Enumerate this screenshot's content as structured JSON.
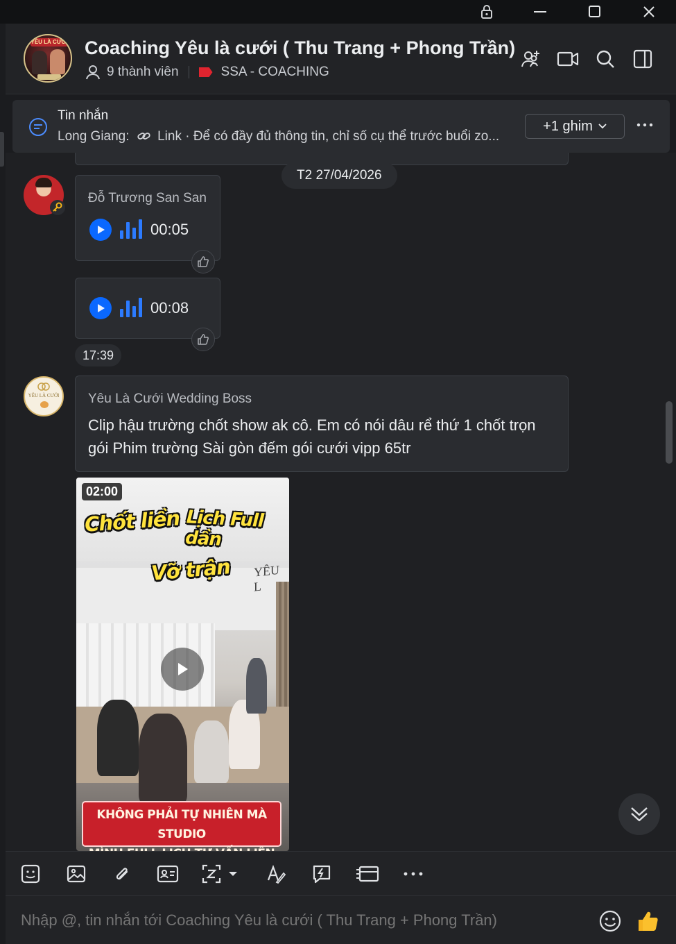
{
  "window": {
    "controls": [
      "lock-icon",
      "minimize-icon",
      "maximize-icon",
      "close-icon"
    ]
  },
  "header": {
    "title": "Coaching Yêu là cưới ( Thu Trang + Phong Trần)",
    "avatar_banner": "YÊU LÀ CƯỚI",
    "members": "9 thành viên",
    "tag": "SSA - COACHING",
    "tag_color": "#e0242f",
    "actions": [
      "add-member-icon",
      "video-call-icon",
      "search-icon",
      "sidebar-toggle-icon"
    ]
  },
  "pinned": {
    "title": "Tin nhắn",
    "sender": "Long Giang:",
    "link_label": "Link",
    "preview": "· Để có đầy đủ thông tin, chỉ số cụ thể trước buổi zo...",
    "button": "+1 ghim"
  },
  "messages": {
    "date": "T2 27/04/2026",
    "voice_sender": "Đỗ Trương San San",
    "voice_1_duration": "00:05",
    "voice_2_duration": "00:08",
    "voice_time": "17:39",
    "text_sender": "Yêu Là Cưới Wedding Boss",
    "text_body": "Clip hậu trường chốt show ak cô. Em có nói dâu rể thứ 1 chốt trọn gói Phim trường Sài gòn đếm gói cưới vipp 65tr",
    "avatar_logo_text": "YÊU LÀ CƯỚI",
    "video": {
      "duration": "02:00",
      "caption_1": "Chốt liền",
      "caption_2": "Lịch Full dần",
      "caption_3": "Vỡ trận",
      "sign": "YÊU L",
      "banner_line_1": "KHÔNG PHẢI TỰ NHIÊN MÀ STUDIO",
      "banner_line_2": "MÌNH FULL LỊCH TƯ VẤN LIÊN TỤC"
    }
  },
  "toolbar": {
    "tools": [
      "sticker-icon",
      "image-icon",
      "attachment-icon",
      "contact-card-icon",
      "screenshot-icon",
      "format-text-icon",
      "quick-message-icon",
      "todo-icon",
      "more-icon"
    ]
  },
  "composer": {
    "placeholder": "Nhập @, tin nhắn tới Coaching Yêu là cưới ( Thu Trang + Phong Trần)",
    "icons": [
      "emoji-icon",
      "thumbs-up-icon"
    ]
  },
  "colors": {
    "accent": "#0a68ff",
    "background": "#1f2023",
    "bubble": "#2a2c30"
  }
}
